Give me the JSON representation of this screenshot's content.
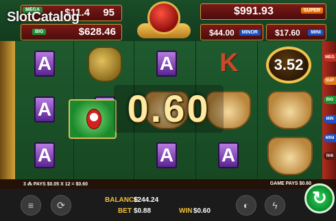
{
  "watermark": "SlotCatalog",
  "jackpots": {
    "mega_tag": "MEGA",
    "top_left_value": "$11.4",
    "top_left_suffix": "95",
    "top_left_label": "BIG",
    "big_value": "$628.46",
    "super_value": "$991.93",
    "super_label": "SUPER",
    "minor_value": "$44.00",
    "minor_label": "MINOR",
    "mini_value": "$17.60",
    "mini_label": "MINI"
  },
  "reels": {
    "symbol_a": "A",
    "symbol_k": "K",
    "coin_value": "3.52"
  },
  "win_display": "0.60",
  "side_tabs": [
    "MEG",
    "SUP",
    "BIG",
    "MIN",
    "MINI",
    "link"
  ],
  "info_bar": {
    "left_text": "3 ⁂ PAYS $0.05 X 12 = $0.60",
    "right_text": "GAME PAYS $0.60"
  },
  "controls": {
    "balance_label": "BALANCE",
    "balance_value": "$244.24",
    "bet_label": "BET",
    "bet_value": "$0.88",
    "win_label": "WIN",
    "win_value": "$0.60",
    "settings_icon": "sliders-icon",
    "autoplay_icon": "autoplay-icon",
    "turbo_icon": "lightning-icon",
    "spin_icon": "spin-arrow-icon"
  },
  "colors": {
    "accent_gold": "#f2c13a",
    "spin_green": "#0b8a2c",
    "jackpot_red": "#7b1a17"
  }
}
